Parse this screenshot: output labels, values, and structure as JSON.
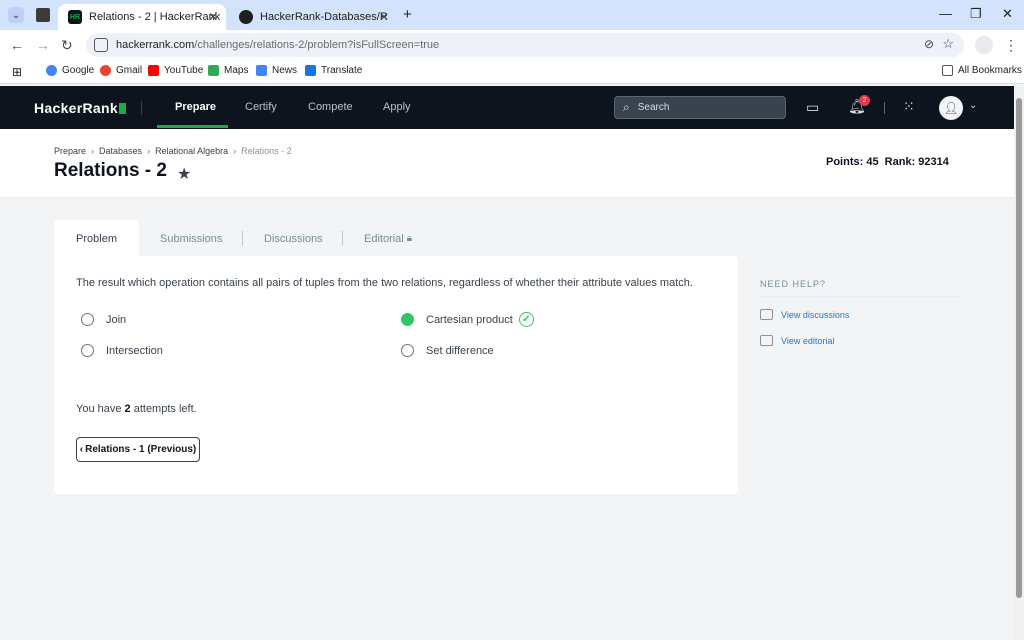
{
  "browser": {
    "tabs": [
      {
        "title": "Relations - 2 | HackerRank",
        "active": true,
        "favicon": "HR"
      },
      {
        "title": "HackerRank-Databases/Relatio",
        "active": false
      }
    ],
    "url_host": "hackerrank.com",
    "url_path": "/challenges/relations-2/problem?isFullScreen=true",
    "bookmarks": [
      "Google",
      "Gmail",
      "YouTube",
      "Maps",
      "News",
      "Translate"
    ],
    "all_bookmarks": "All Bookmarks"
  },
  "header": {
    "logo": "HackerRank",
    "nav": [
      "Prepare",
      "Certify",
      "Compete",
      "Apply"
    ],
    "search_placeholder": "Search",
    "notifications_count": "2"
  },
  "title_band": {
    "breadcrumbs": [
      "Prepare",
      "Databases",
      "Relational Algebra",
      "Relations - 2"
    ],
    "title": "Relations - 2",
    "points": "Points: 45  Rank: 92314"
  },
  "content_tabs": [
    "Problem",
    "Submissions",
    "Discussions",
    "Editorial"
  ],
  "problem": {
    "question": "The result which operation contains all pairs of tuples from the two relations, regardless of whether their attribute values match.",
    "options": [
      {
        "label": "Join",
        "checked": false
      },
      {
        "label": "Intersection",
        "checked": false
      },
      {
        "label": "Cartesian product",
        "checked": true
      },
      {
        "label": "Set difference",
        "checked": false
      }
    ],
    "attempts_prefix": "You have ",
    "attempts_count": "2",
    "attempts_suffix": " attempts left.",
    "prev_button": "Relations - 1 (Previous)"
  },
  "help": {
    "title": "NEED HELP?",
    "links": [
      "View discussions",
      "View editorial"
    ]
  },
  "colors": {
    "hr_dark": "#0e141e",
    "hr_green": "#1ba94c",
    "correct_green": "#2ec866",
    "link_blue": "#1f78d1"
  }
}
